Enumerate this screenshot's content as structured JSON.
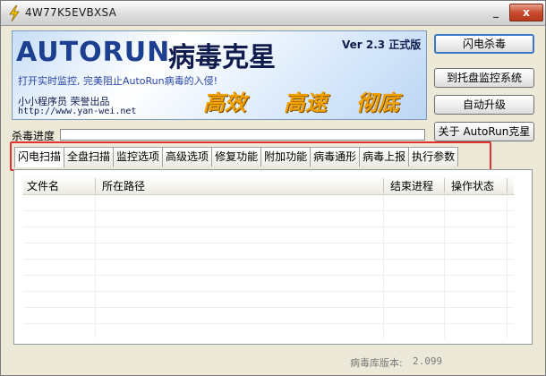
{
  "window": {
    "title": "4W77K5EVBXSA",
    "minimize_glyph": "_",
    "close_glyph": "x"
  },
  "banner": {
    "logo_text": "AUTORUN",
    "product_name": "病毒克星",
    "version": "Ver 2.3 正式版",
    "slogan": "打开实时监控, 完美阻止AutoRun病毒的入侵!",
    "taglines": [
      "高效",
      "高速",
      "彻底"
    ],
    "author": "小小程序员 荣誉出品",
    "url": "http://www.yan-wei.net"
  },
  "buttons": {
    "flash_kill": "闪电杀毒",
    "tray_monitor": "到托盘监控系统",
    "auto_upgrade": "自动升级",
    "about": "关于 AutoRun克星"
  },
  "progress": {
    "label": "杀毒进度",
    "value": 0
  },
  "tabs": [
    {
      "label": "闪电扫描",
      "active": true
    },
    {
      "label": "全盘扫描",
      "active": false
    },
    {
      "label": "监控选项",
      "active": false
    },
    {
      "label": "高级选项",
      "active": false
    },
    {
      "label": "修复功能",
      "active": false
    },
    {
      "label": "附加功能",
      "active": false
    },
    {
      "label": "病毒通形",
      "active": false
    },
    {
      "label": "病毒上报",
      "active": false
    },
    {
      "label": "执行参数",
      "active": false
    }
  ],
  "list": {
    "columns": [
      "文件名",
      "所在路径",
      "结束进程",
      "操作状态"
    ],
    "rows": []
  },
  "status": {
    "db_label": "病毒库版本:",
    "db_version": "2.099"
  },
  "colors": {
    "highlight_border": "#e23333",
    "title_close": "#c84c2e",
    "tagline": "#f0a000",
    "logo": "#1c3f8f"
  }
}
